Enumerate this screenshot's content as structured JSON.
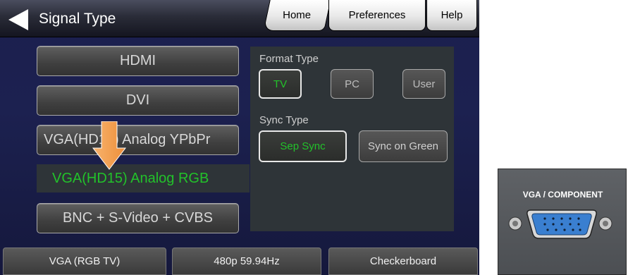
{
  "header": {
    "title": "Signal Type",
    "tabs": {
      "home": "Home",
      "preferences": "Preferences",
      "help": "Help"
    }
  },
  "signal_buttons": {
    "hdmi": "HDMI",
    "dvi": "DVI",
    "vga_ypbpr": "VGA(HD15) Analog YPbPr",
    "vga_rgb": "VGA(HD15) Analog RGB",
    "bnc": "BNC + S-Video + CVBS"
  },
  "format_panel": {
    "format_label": "Format Type",
    "format_options": {
      "tv": "TV",
      "pc": "PC",
      "user": "User"
    },
    "format_selected": "TV",
    "sync_label": "Sync Type",
    "sync_options": {
      "sep": "Sep Sync",
      "sog": "Sync on Green"
    },
    "sync_selected": "Sep Sync"
  },
  "status_bar": {
    "signal": "VGA (RGB TV)",
    "timing": "480p 59.94Hz",
    "pattern": "Checkerboard"
  },
  "connector_photo": {
    "label": "VGA / COMPONENT"
  },
  "colors": {
    "active_text": "#22c22a",
    "arrow": "#f5a04a",
    "background": "#1b1f4e",
    "panel": "#2e3438",
    "vga_port": "#3a7fd0"
  },
  "icons": {
    "back": "back-arrow-icon",
    "pointer": "down-arrow-icon",
    "port": "vga-port-icon",
    "screw": "screw-icon"
  }
}
